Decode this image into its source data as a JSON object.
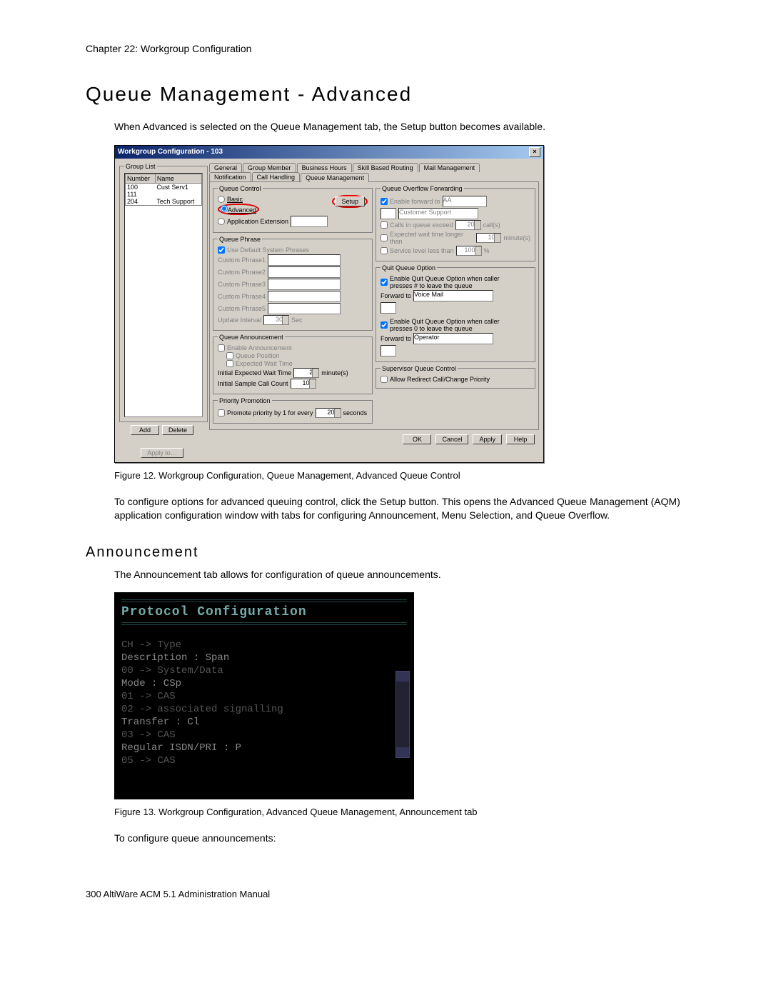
{
  "chapter": "Chapter 22:  Workgroup Configuration",
  "h1": "Queue Management - Advanced",
  "intro": "When Advanced is selected on the Queue Management tab, the Setup button becomes available.",
  "fig1_caption": "Figure 12.   Workgroup Configuration, Queue Management, Advanced Queue Control",
  "para2": "To configure options for advanced queuing control, click the Setup button. This opens the Advanced Queue Management (AQM) application configuration window with tabs for configuring Announcement, Menu Selection, and Queue Overflow.",
  "h2": "Announcement",
  "para3": "The Announcement tab allows for configuration of queue announcements.",
  "fig2_caption": "Figure 13.   Workgroup Configuration, Advanced Queue Management, Announcement tab",
  "para4": "To configure queue announcements:",
  "footer": "300   AltiWare ACM 5.1 Administration Manual",
  "dialog": {
    "title": "Workgroup Configuration - 103",
    "group_list_legend": "Group List",
    "col_number": "Number",
    "col_name": "Name",
    "rows": [
      {
        "num": "100",
        "name": "Cust Serv1"
      },
      {
        "num": "111",
        "name": ""
      },
      {
        "num": "204",
        "name": "Tech Support"
      }
    ],
    "add": "Add",
    "delete": "Delete",
    "apply_left": "Apply to…",
    "tabs_row1": [
      "General",
      "Group Member",
      "Business Hours",
      "Skill Based Routing",
      "Mail Management"
    ],
    "tabs_row2": [
      "Notification",
      "Call Handling",
      "Queue Management"
    ],
    "queue_control_legend": "Queue Control",
    "radio_basic": "Basic",
    "radio_advanced": "Advanced",
    "radio_appext": "Application Extension",
    "setup_btn": "Setup",
    "queue_phrase_legend": "Queue Phrase",
    "use_default_phrases": "Use Default System Phrases",
    "phrase_labels": [
      "Custom Phrase1",
      "Custom Phrase2",
      "Custom Phrase3",
      "Custom Phrase4",
      "Custom Phrase5"
    ],
    "update_interval": "Update Interval",
    "update_interval_val": "30",
    "sec": "Sec",
    "announce_legend": "Queue Announcement",
    "enable_announce": "Enable Announcement",
    "queue_position": "Queue Position",
    "expected_wait": "Expected Wait Time",
    "init_wait": "Initial Expected Wait Time",
    "init_wait_val": "2",
    "minutes": "minute(s)",
    "init_sample": "Initial Sample Call Count",
    "init_sample_val": "10",
    "priority_legend": "Priority Promotion",
    "promote": "Promote priority by 1 for every",
    "promote_val": "20",
    "seconds": "seconds",
    "overflow_legend": "Queue Overflow Forwarding",
    "ovf_enable": "Enable forward to",
    "ovf_target1": "AA",
    "ovf_target2": "Customer Support",
    "ovf_calls": "Calls in queue exceed",
    "ovf_calls_val": "20",
    "ovf_calls_unit": "call(s)",
    "ovf_wait": "Expected wait time longer than",
    "ovf_wait_val": "10",
    "ovf_wait_unit": "minute(s)",
    "ovf_svc": "Service level less than",
    "ovf_svc_val": "100",
    "ovf_svc_unit": "%",
    "quit_legend": "Quit Queue Option",
    "quit_enable": "Enable Quit Queue Option when caller presses # to leave the queue",
    "fwd_to1": "Forward to",
    "fwd_to1_val": "Voice Mail",
    "quit_cb2": "Enable Quit Queue Option when caller presses 0 to leave the queue",
    "fwd_to2": "Forward to",
    "fwd_to2_val": "Operator",
    "super_legend": "Supervisor Queue Control",
    "super_allow": "Allow Redirect Call/Change Priority",
    "ok": "OK",
    "cancel": "Cancel",
    "apply": "Apply",
    "help": "Help"
  },
  "fig2": {
    "header": "Protocol Configuration",
    "lines": [
      "  CH  -> Type",
      "Description            :  Span",
      "  00 -> System/Data",
      "Mode                   :  CSp",
      "  01 -> CAS",
      "  02 -> associated signalling",
      "Transfer               :  Cl",
      "  03 -> CAS",
      "Regular ISDN/PRI       :  P",
      "  05 -> CAS"
    ]
  }
}
